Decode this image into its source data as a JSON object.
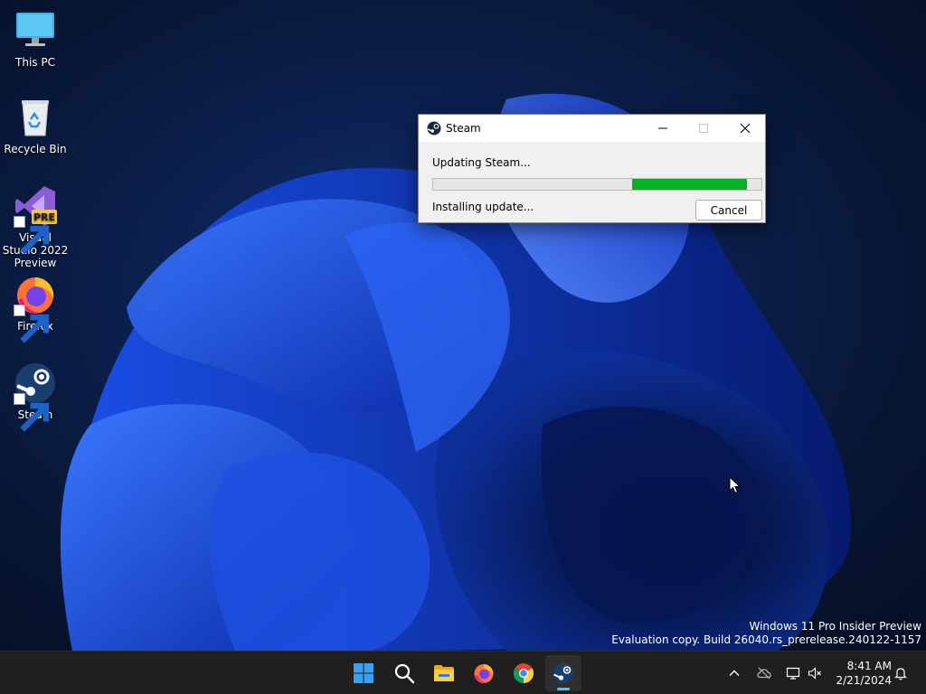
{
  "desktop": {
    "icons": [
      {
        "label": "This PC",
        "icon": "monitor-icon"
      },
      {
        "label": "Recycle Bin",
        "icon": "recycle-bin-icon"
      },
      {
        "label": "Visual Studio 2022 Preview",
        "icon": "visual-studio-icon",
        "badge": "PRE"
      },
      {
        "label": "Firefox",
        "icon": "firefox-icon"
      },
      {
        "label": "Steam",
        "icon": "steam-icon"
      }
    ],
    "watermark": {
      "line1": "Windows 11 Pro Insider Preview",
      "line2": "Evaluation copy. Build 26040.rs_prerelease.240122-1157"
    }
  },
  "dialog": {
    "title": "Steam",
    "status": "Updating Steam...",
    "detail": "Installing update...",
    "cancel_label": "Cancel",
    "progress": {
      "start": 0.605,
      "end": 0.955,
      "color": "#06b025"
    }
  },
  "taskbar": {
    "apps": [
      {
        "name": "start",
        "icon": "windows-logo-icon"
      },
      {
        "name": "search",
        "icon": "search-icon"
      },
      {
        "name": "file-explorer",
        "icon": "folder-icon"
      },
      {
        "name": "firefox",
        "icon": "firefox-icon"
      },
      {
        "name": "chrome",
        "icon": "chrome-icon"
      },
      {
        "name": "steam",
        "icon": "steam-icon",
        "active": true
      }
    ],
    "tray": [
      "chevron-up-icon",
      "cloud-offline-icon",
      "network-icon",
      "volume-muted-icon"
    ],
    "clock": {
      "time": "8:41 AM",
      "date": "2/21/2024"
    },
    "accent": "#4cc2ff"
  }
}
